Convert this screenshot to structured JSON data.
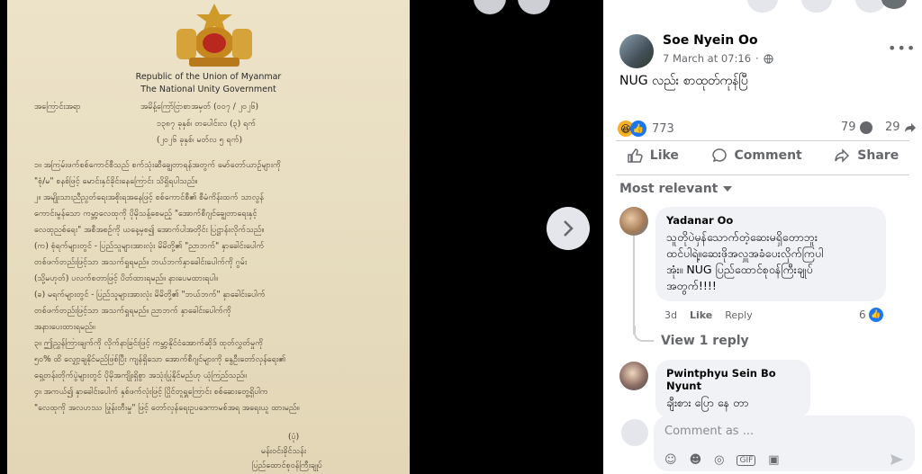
{
  "post": {
    "author": "Soe Nyein Oo",
    "timestamp": "7 March at 07:16",
    "text": "NUG လည်း စာထုတ်ကုန်ပြီ",
    "reaction_count": "773",
    "comment_count": "79",
    "share_count": "29"
  },
  "actions": {
    "like": "Like",
    "comment": "Comment",
    "share": "Share"
  },
  "sort_label": "Most relevant",
  "comments": [
    {
      "author": "Yadanar Oo",
      "lines": [
        "သူတိုပဲမှန်သောက်တဲ့ဆေးမရှိတောဘူး",
        "ထင်ပါရဲ့။ဆေးဖိုအလှူအခံပေးလိုက်ကြပါ",
        "အုံး။ NUG ပြည်ထောင်စုဝန်ကြီးချုပ်",
        "အတွက်!!!!"
      ],
      "age": "3d",
      "like": "Like",
      "reply": "Reply",
      "likes": "6",
      "view_replies": "View 1 reply"
    },
    {
      "author": "Pwintphyu Sein Bo Nyunt",
      "lines": [
        "ချီးစား ပြော နေ တာ"
      ]
    }
  ],
  "composer": {
    "placeholder": "Comment as ..."
  },
  "document": {
    "header_en_1": "Republic of the Union of Myanmar",
    "header_en_2": "The National Unity Government",
    "subject_label": "အကြောင်းအရာ",
    "subject_text": "အမိန့်ကြော်ငြာစာအမှတ် (၀၀၇ / ၂၀၂၆)",
    "date_line_1": "၁၃၈၇ ခုနှစ်၊ တပေါင်းလ (၃) ရက်",
    "date_line_2": "(၂၀၂၆ ခုနှစ်၊ မတ်လ ၅ ရက်)",
    "body_lines": [
      "၁။   အကြမ်းဖက်စစ်ကောင်စီသည် စက်သုံးဆီချွေတာရန်အတွက် မော်တော်ယာဉ်များကို",
      "      \"စုံ/မ\" စနစ်ဖြင့် မောင်းနှင်ခိုင်းနေကြောင်း သိရှိရပါသည်။",
      "၂။   အမျိုးသားညီညွတ်ရေးအစိုးရအနေဖြင့် စစ်ကောင်စီ၏ စီမံကိန်းထက် သာလွန်",
      "      ကောင်းမွန်သော ကမ္ဘာ့လေထုကို ပိုမိုသန့်စေမည့် \"အောက်စီဂျင်ချွေတာရေးနှင့်",
      "      လေထုညစ်ရေး\" အစီအစဉ်ကို ယနေ့မှစ၍ အောက်ပါအတိုင်း ပြဋ္ဌာန်းလိုက်သည်။",
      "      (က)  စုံရက်များတွင် - ပြည်သူများအားလုံး မိမိတို့၏ \"ညာဘက်\" နှာခေါင်းပေါက်",
      "            တစ်ဖက်တည်းဖြင့်သာ အသက်ရှုရမည်။ ဘယ်ဘက်နှာခေါင်းပေါက်ကို ဂွမ်း",
      "            (သို့မဟုတ်) ပလက်စတာဖြင့် ပိတ်ထားရမည်။ နားပေမထားရပါ။",
      "      (ခ)  မရက်များတွင် - ပြည်သူများအားလုံး မိမိတို့၏ \"ဘယ်ဘက်\" နှာခေါင်းပေါက်",
      "            တစ်ဖက်တည်းဖြင့်သာ အသက်ရှုရမည်။  ညာဘက် နှာခေါင်းပေါက်ကို",
      "            အနားပေးထားရမည်။",
      "၃။   ဤညွှန်ကြားချက်ကို လိုက်နာခြင်းဖြင့် ကမ္ဘာ့နိုင်ငံအောက်ဆိုဒ် ထုတ်လွှတ်မှုကို",
      "      ၅၀% ထိ လျှော့ချနိုင်မည်ဖြစ်ပြီး ကျန်ရှိသော အောက်စီဂျင်များကို နွေဦးတော်လှန်ရေး၏",
      "      ရှေ့တန်းတိုက်ပွဲများတွင် ပိုမိုအကျိုးရှိစွာ အသုံးပြုနိုင်မည်ဟု ယုံကြည်သည်။",
      "၄။   အကယ်၍ နှာခေါင်းပေါက် နှစ်ဖက်လုံးဖြင့် ပြိုင်တူရှူကြောင်း စစ်ဆေးတွေ့ရှိပါက",
      "      \"လေထုကို အလဟဿ ဖြုန်းတီးမှု\" ဖြင့် တော်လှန်ရေးဥပဒေကာမစ်အရ အရေးယူ ထားမည်။"
    ],
    "signature_1": "(ပုံ)",
    "signature_2": "မန်းဝင်းခိုင်သန်း",
    "signature_3": "ပြည်ထောင်စုဝန်ကြီးချုပ်"
  }
}
